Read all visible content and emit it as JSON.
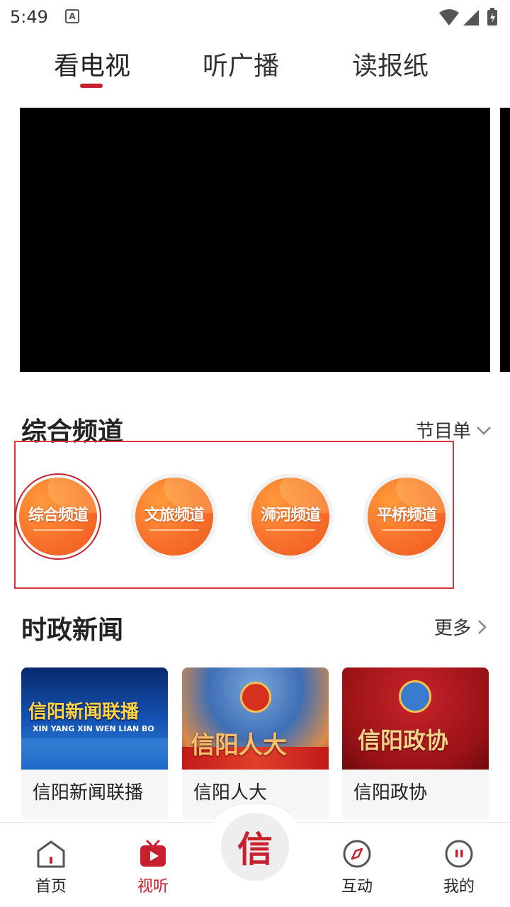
{
  "status_bar": {
    "time": "5:49",
    "notification_letter": "A"
  },
  "top_tabs": [
    {
      "label": "看电视",
      "active": true
    },
    {
      "label": "听广播",
      "active": false
    },
    {
      "label": "读报纸",
      "active": false
    }
  ],
  "channels_section": {
    "title": "综合频道",
    "schedule_label": "节目单",
    "channels": [
      {
        "name": "综合频道",
        "selected": true
      },
      {
        "name": "文旅频道",
        "selected": false
      },
      {
        "name": "浉河频道",
        "selected": false
      },
      {
        "name": "平桥频道",
        "selected": false
      }
    ]
  },
  "news_section": {
    "title": "时政新闻",
    "more_label": "更多",
    "cards": [
      {
        "label": "信阳新闻联播",
        "thumb_title": "信阳新闻联播",
        "thumb_subtitle": "XIN YANG XIN WEN LIAN BO"
      },
      {
        "label": "信阳人大",
        "thumb_title": "信阳人大"
      },
      {
        "label": "信阳政协",
        "thumb_title": "信阳政协"
      }
    ]
  },
  "bottom_nav": {
    "items": [
      {
        "label": "首页",
        "icon": "home-icon",
        "active": false
      },
      {
        "label": "视听",
        "icon": "tv-play-icon",
        "active": true
      },
      {
        "label": "互动",
        "icon": "compass-icon",
        "active": false
      },
      {
        "label": "我的",
        "icon": "profile-icon",
        "active": false
      }
    ],
    "center_glyph": "信"
  },
  "colors": {
    "accent": "#c8202d",
    "channel_orange": "#f7702a",
    "text": "#222222"
  }
}
